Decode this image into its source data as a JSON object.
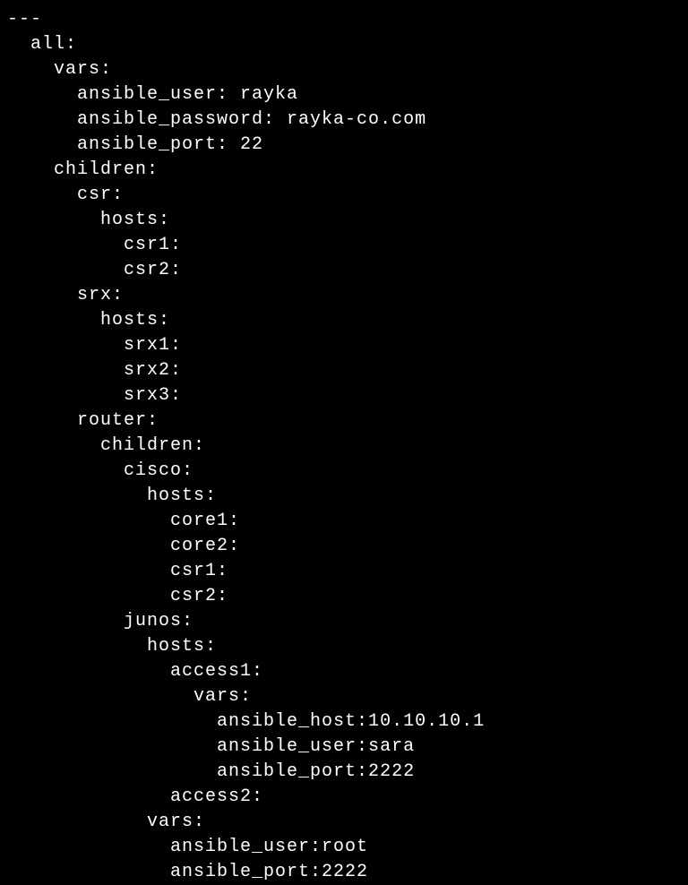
{
  "yaml": {
    "doc_start": "---",
    "lines": [
      {
        "indent": 0,
        "text": "all:"
      },
      {
        "indent": 1,
        "text": "vars:"
      },
      {
        "indent": 2,
        "text": "ansible_user: rayka"
      },
      {
        "indent": 2,
        "text": "ansible_password: rayka-co.com"
      },
      {
        "indent": 2,
        "text": "ansible_port: 22"
      },
      {
        "indent": 1,
        "text": "children:"
      },
      {
        "indent": 2,
        "text": "csr:"
      },
      {
        "indent": 3,
        "text": "hosts:"
      },
      {
        "indent": 4,
        "text": "csr1:"
      },
      {
        "indent": 4,
        "text": "csr2:"
      },
      {
        "indent": 2,
        "text": "srx:"
      },
      {
        "indent": 3,
        "text": "hosts:"
      },
      {
        "indent": 4,
        "text": "srx1:"
      },
      {
        "indent": 4,
        "text": "srx2:"
      },
      {
        "indent": 4,
        "text": "srx3:"
      },
      {
        "indent": 2,
        "text": "router:"
      },
      {
        "indent": 3,
        "text": "children:"
      },
      {
        "indent": 4,
        "text": "cisco:"
      },
      {
        "indent": 5,
        "text": "hosts:"
      },
      {
        "indent": 6,
        "text": "core1:"
      },
      {
        "indent": 6,
        "text": "core2:"
      },
      {
        "indent": 6,
        "text": "csr1:"
      },
      {
        "indent": 6,
        "text": "csr2:"
      },
      {
        "indent": 4,
        "text": "junos:"
      },
      {
        "indent": 5,
        "text": "hosts:"
      },
      {
        "indent": 6,
        "text": "access1:"
      },
      {
        "indent": 7,
        "text": "vars:"
      },
      {
        "indent": 8,
        "text": "ansible_host:10.10.10.1"
      },
      {
        "indent": 8,
        "text": "ansible_user:sara"
      },
      {
        "indent": 8,
        "text": "ansible_port:2222"
      },
      {
        "indent": 6,
        "text": "access2:"
      },
      {
        "indent": 5,
        "text": "vars:"
      },
      {
        "indent": 6,
        "text": "ansible_user:root"
      },
      {
        "indent": 6,
        "text": "ansible_port:2222"
      }
    ]
  }
}
